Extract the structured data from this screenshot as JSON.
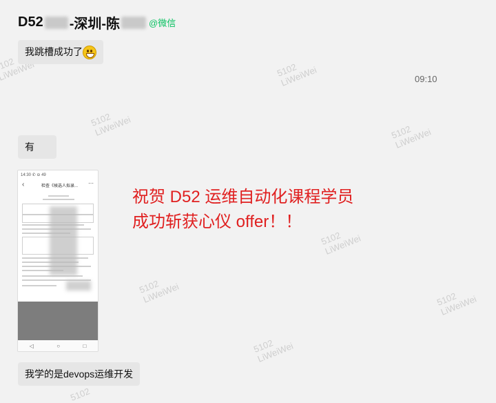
{
  "header": {
    "title_prefix": "D52",
    "title_middle": "-深圳-陈",
    "wechat_tag": "@微信"
  },
  "messages": [
    {
      "text": "我跳槽成功了",
      "emoji": "grinning-face-icon"
    },
    {
      "time": "09:10"
    },
    {
      "text": "有"
    },
    {
      "type": "image",
      "status": "14:30 ✆ ⊖ 49",
      "title": "检查《候选人拟录...",
      "nav": [
        "◁",
        "○",
        "□"
      ]
    },
    {
      "text": "我学的是devops运维开发"
    }
  ],
  "announcement": {
    "line1": "祝贺 D52 运维自动化课程学员",
    "line2": "成功斩获心仪 offer！！"
  },
  "watermark": {
    "line1": "5102",
    "line2": "LiWeiWei"
  },
  "colors": {
    "background": "#f2f2f2",
    "bubble": "#e6e6e6",
    "announcement": "#e02020",
    "wechat_tag": "#07c160"
  }
}
